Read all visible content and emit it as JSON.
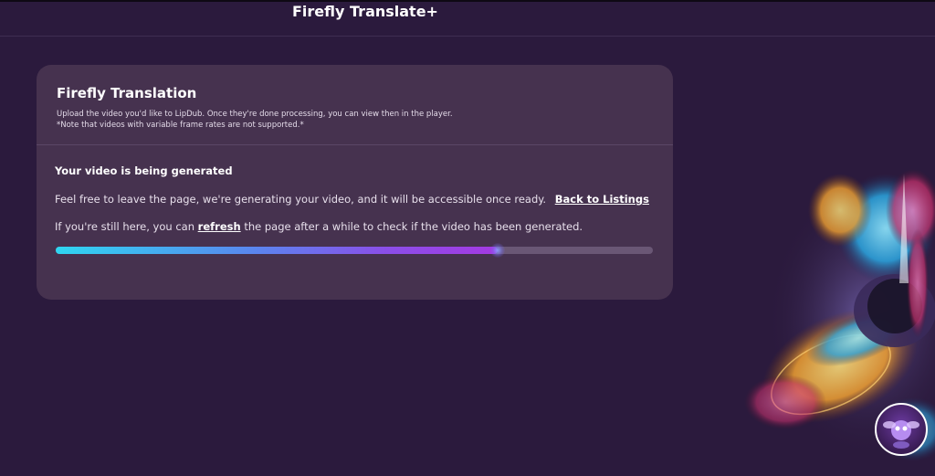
{
  "header": {
    "title": "Firefly Translate+"
  },
  "card": {
    "title": "Firefly Translation",
    "description_line1": "Upload the video you'd like to LipDub. Once they're done processing, you can view then in the player.",
    "description_line2": "*Note that videos with variable frame rates are not supported.*"
  },
  "status": {
    "heading": "Your video is being generated",
    "line1_text": "Feel free to leave the page, we're generating your video, and it will be accessible once ready.",
    "back_link": "Back to Listings",
    "line2_prefix": "If you're still here, you can",
    "refresh_link": "refresh",
    "line2_suffix": "the page after a while to check if the video has been generated.",
    "progress_fraction": 0.74
  },
  "colors": {
    "background": "#2b1a3d",
    "card": "#46324f",
    "progress_start": "#2fd6f0",
    "progress_end": "#a43ae2",
    "progress_track": "#6a5775"
  },
  "icons": {
    "art": "firefly-illustration",
    "avatar": "assistant-avatar-icon"
  }
}
